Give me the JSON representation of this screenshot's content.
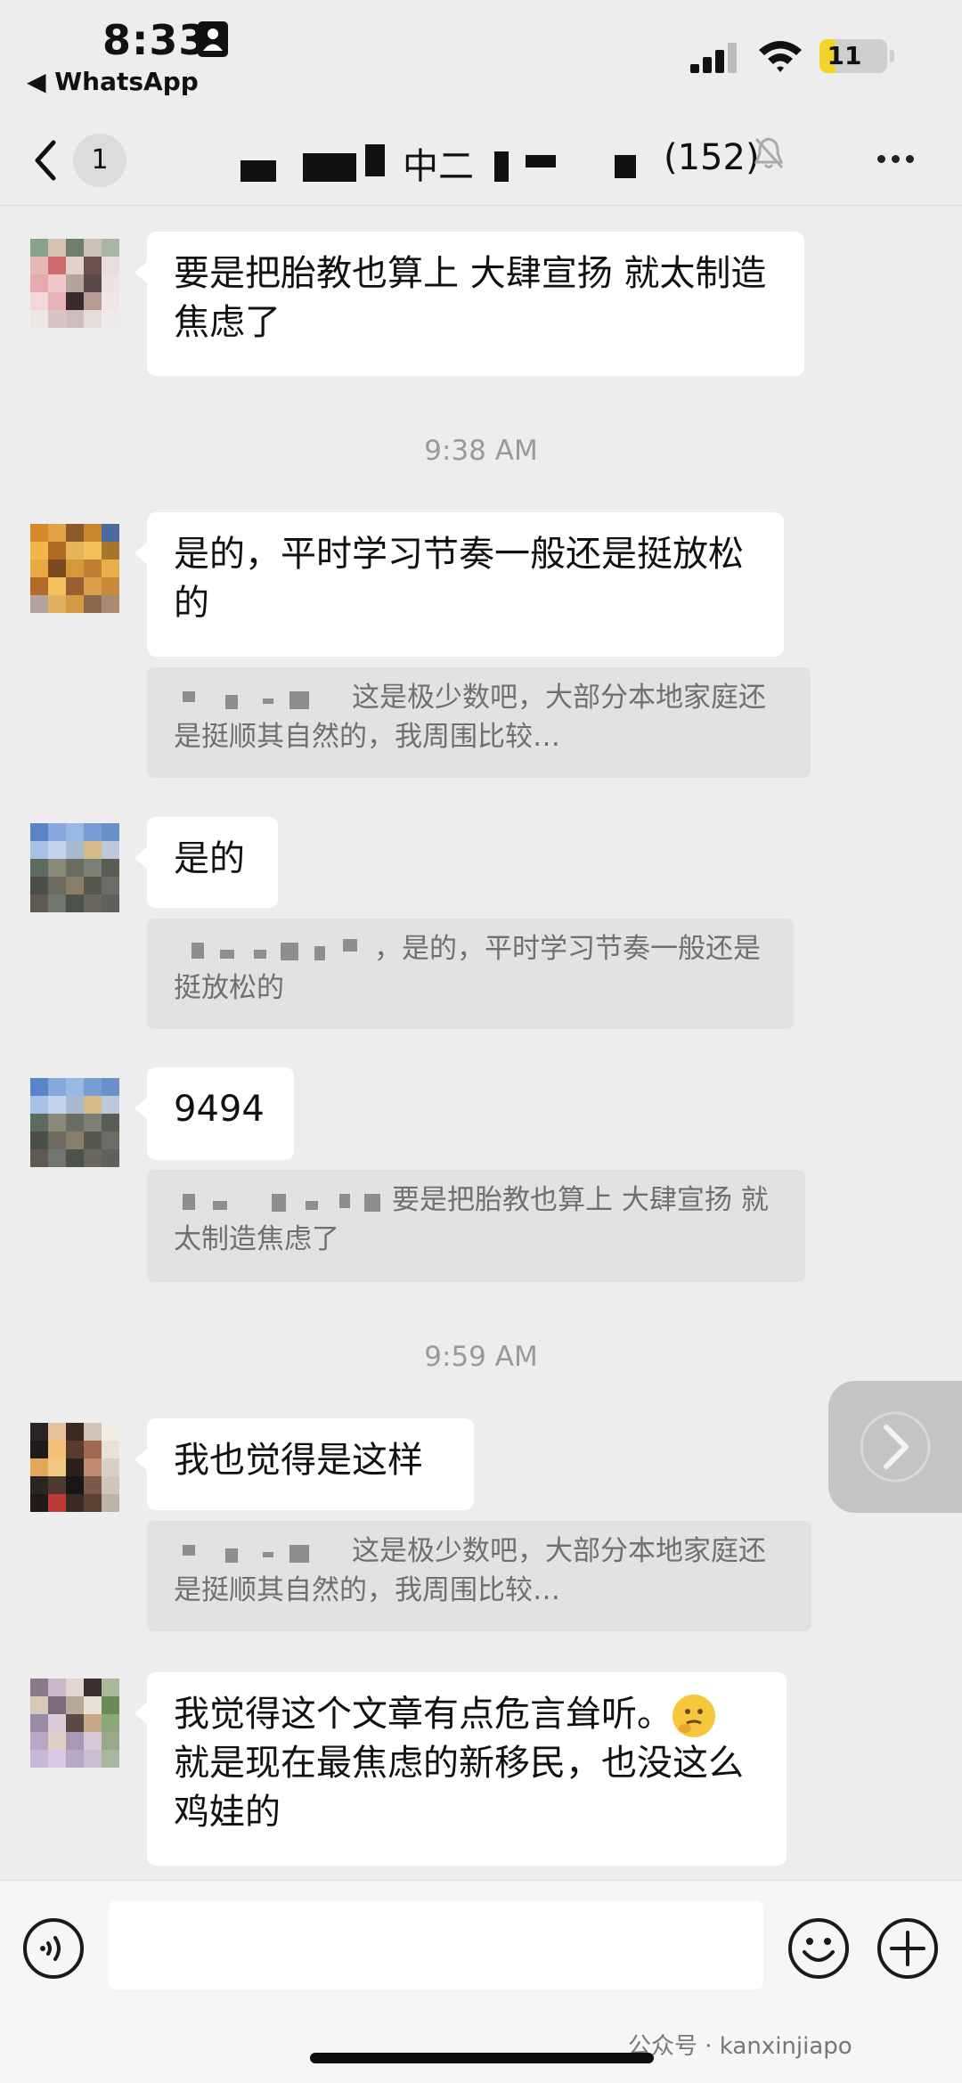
{
  "status_bar": {
    "time": "8:33",
    "back_app": "◀ WhatsApp",
    "battery": "11"
  },
  "header": {
    "unread_count": "1",
    "title_visible": "中二",
    "member_count": "(152)"
  },
  "messages": [
    {
      "text": "要是把胎教也算上 大肆宣扬 就太制造焦虑了"
    },
    {
      "timestamp": "9:38 AM"
    },
    {
      "text": "是的，平时学习节奏一般还是挺放松的",
      "quote": "这是极少数吧，大部分本地家庭还是挺顺其自然的，我周围比较…"
    },
    {
      "text": "是的",
      "quote": "，是的，平时学习节奏一般还是挺放松的"
    },
    {
      "text": "9494",
      "quote": "要是把胎教也算上 大肆宣扬 就太制造焦虑了"
    },
    {
      "timestamp": "9:59 AM"
    },
    {
      "text": "我也觉得是这样",
      "quote": "这是极少数吧，大部分本地家庭还是挺顺其自然的，我周围比较…"
    },
    {
      "text": "我觉得这个文章有点危言耸听。",
      "text2": "就是现在最焦虑的新移民，也没这么鸡娃的"
    }
  ],
  "watermark": "公众号 · kanxinjiapo",
  "icons": [
    "person-id-icon",
    "signal-icon",
    "wifi-icon",
    "battery-icon",
    "back-chevron-icon",
    "mute-bell-icon",
    "more-icon",
    "chevron-right-icon",
    "voice-icon",
    "emoji-icon",
    "plus-icon"
  ]
}
